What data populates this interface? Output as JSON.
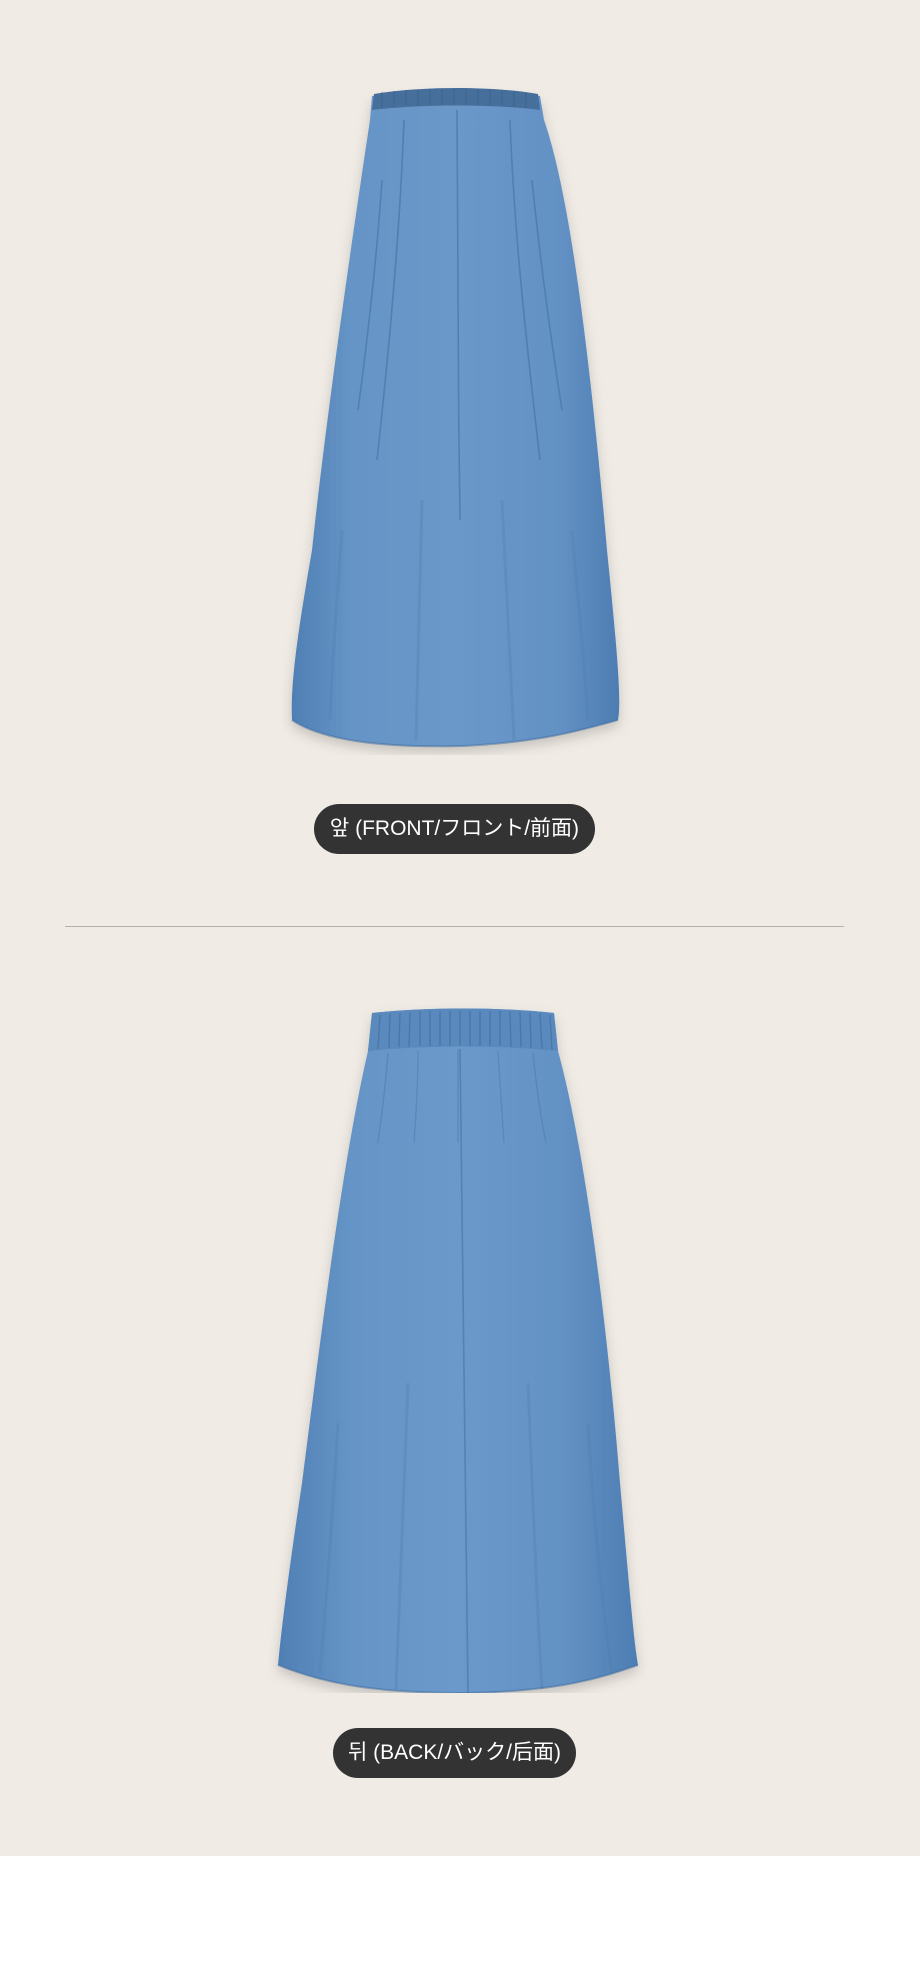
{
  "front": {
    "label": "앞 (FRONT/フロント/前面)"
  },
  "back": {
    "label": "뒤 (BACK/バック/后面)"
  },
  "colors": {
    "background": "#f0ebe5",
    "skirt": "#5f8fc2",
    "pill": "#333333",
    "pill_text": "#ffffff",
    "divider": "#b5b0ab"
  }
}
